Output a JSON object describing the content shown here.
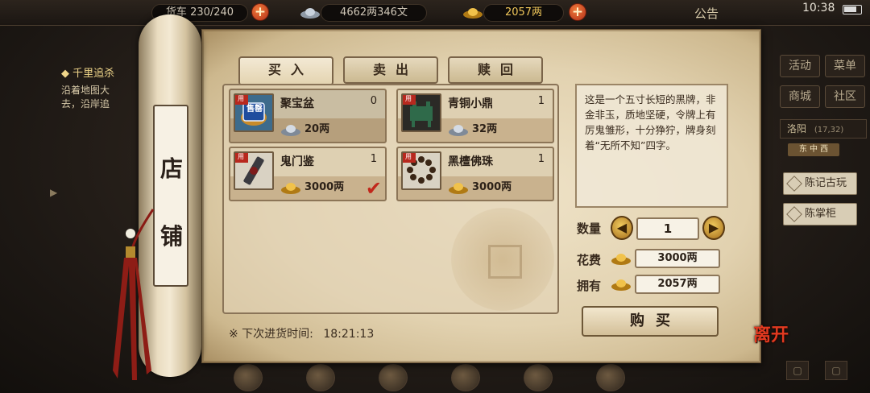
{
  "topbar": {
    "bag_label": "货车",
    "bag_value": "230/240",
    "silver": "4662两346文",
    "gold": "2057两",
    "notice": "公告",
    "clock": "10:38"
  },
  "quest": {
    "title": "◆ 千里追杀",
    "lines": [
      "沿着地图大",
      "去，沿岸追"
    ]
  },
  "side": {
    "btn_activity": "活动",
    "btn_menu": "菜单",
    "btn_shop": "商城",
    "btn_community": "社区",
    "location": "洛阳",
    "coord": "(17,32)",
    "minimap_tab": "东 中 西",
    "npc1": "陈记古玩",
    "npc2": "陈掌柜"
  },
  "shop": {
    "roller_chars": [
      "店",
      "铺"
    ],
    "tabs": [
      "买入",
      "卖出",
      "赎回"
    ],
    "active_tab": "买入",
    "items": [
      {
        "name": "聚宝盆",
        "count": "0",
        "price": "20两",
        "price_icon": "silver-icon",
        "badge": "售罄",
        "selected": true
      },
      {
        "name": "青铜小鼎",
        "count": "1",
        "price": "32两",
        "price_icon": "silver-icon",
        "badge": "",
        "selected": false
      },
      {
        "name": "鬼门鉴",
        "count": "1",
        "price": "3000两",
        "price_icon": "gold-ingot-icon",
        "badge": "",
        "selected": false,
        "checked": true
      },
      {
        "name": "黑檀佛珠",
        "count": "1",
        "price": "3000两",
        "price_icon": "gold-ingot-icon",
        "badge": "",
        "selected": false
      }
    ],
    "description": "这是一个五寸长短的黑牌，非金非玉，质地坚硬，令牌上有厉鬼雏形，十分狰狞，牌身刻着“无所不知”四字。",
    "qty_label": "数量",
    "qty_value": "1",
    "cost_label": "花费",
    "cost_value": "3000两",
    "owned_label": "拥有",
    "owned_value": "2057两",
    "buy_label": "购买",
    "restock_label": "※ 下次进货时间:",
    "restock_time": "18:21:13",
    "leave_label": "离开"
  },
  "colors": {
    "accent_red": "#c1271b",
    "parchment": "#e2d2b0",
    "gold": "#d9a52c"
  }
}
